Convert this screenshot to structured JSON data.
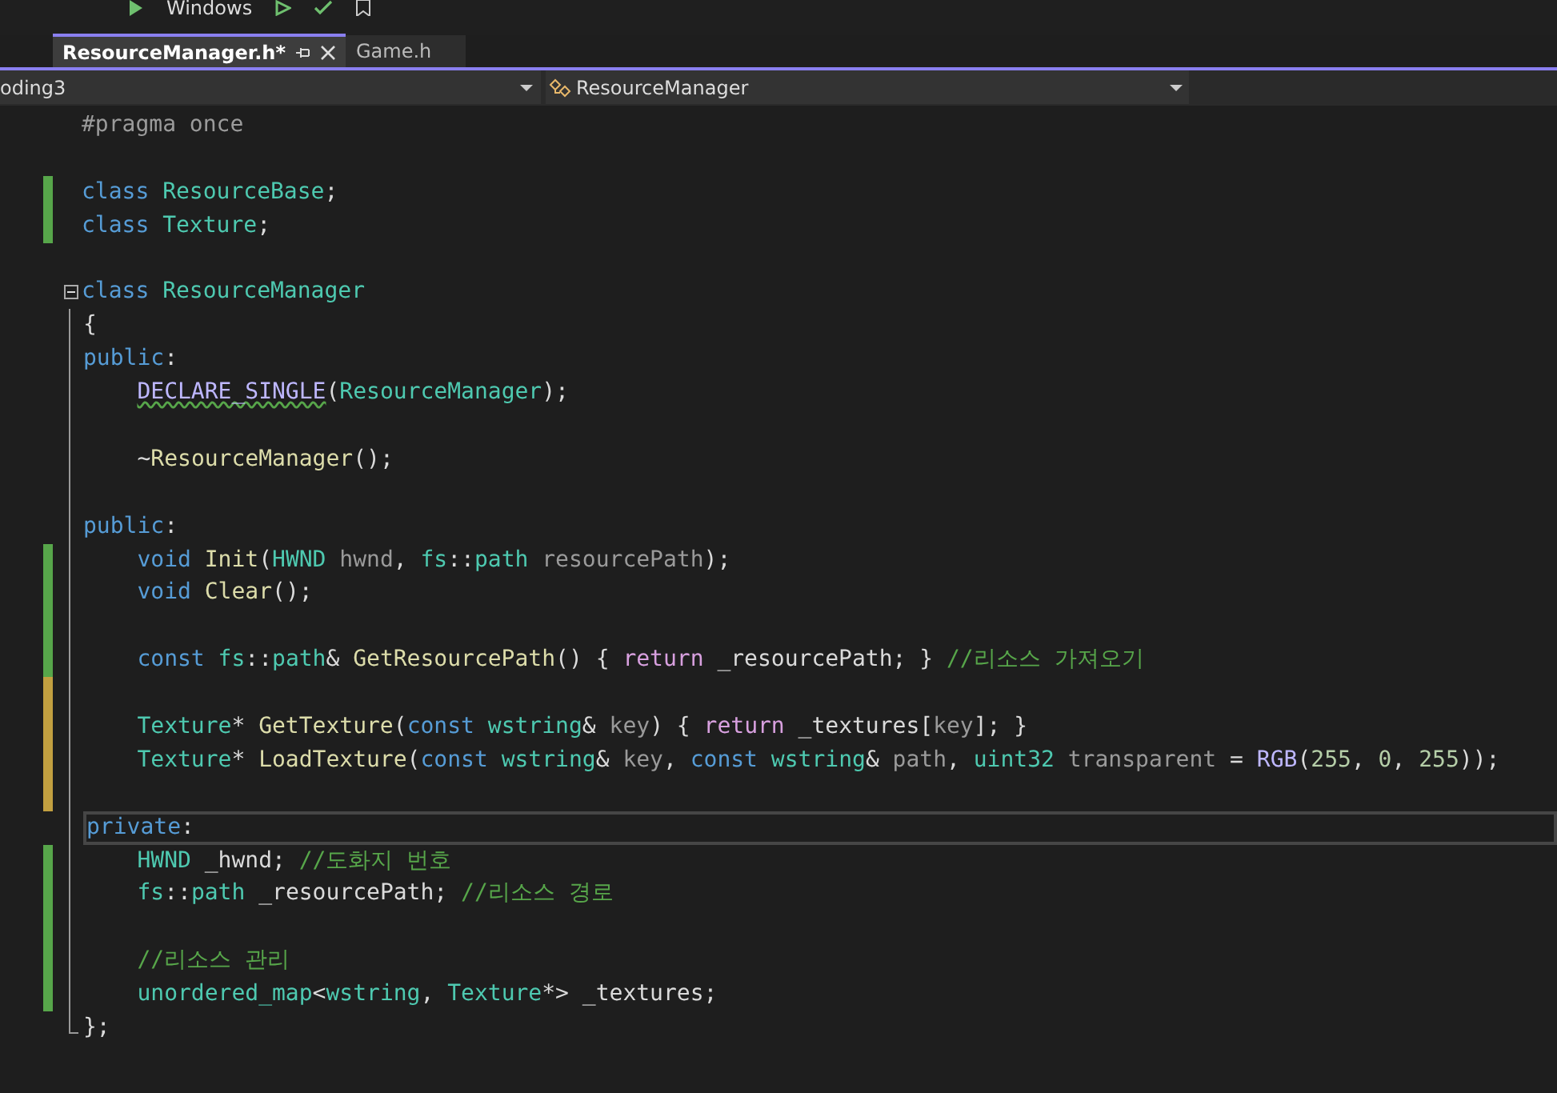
{
  "toolbar": {
    "config_label": "Windows"
  },
  "tabs": [
    {
      "label": "ResourceManager.h*",
      "selected": true
    },
    {
      "label": "Game.h",
      "selected": false
    }
  ],
  "nav": {
    "project": "oding3",
    "scope": "ResourceManager"
  },
  "lines": [
    {
      "current": false,
      "in_block": false,
      "tokens": [
        {
          "kind": "pre",
          "text": "#pragma once"
        }
      ]
    },
    {
      "current": false,
      "in_block": false
    },
    {
      "current": false,
      "in_block": false,
      "marker": {
        "color": "#57a64a"
      },
      "tokens": [
        {
          "kind": "kw",
          "text": "class "
        },
        {
          "kind": "type",
          "text": "ResourceBase"
        },
        {
          "kind": "plain",
          "text": ";"
        }
      ]
    },
    {
      "current": false,
      "in_block": false,
      "marker": {
        "color": "#57a64a"
      },
      "tokens": [
        {
          "kind": "kw",
          "text": "class "
        },
        {
          "kind": "type",
          "text": "Texture"
        },
        {
          "kind": "plain",
          "text": ";"
        }
      ]
    },
    {
      "current": false,
      "in_block": false
    },
    {
      "current": false,
      "collapse_box": true,
      "in_block": false,
      "tokens": [
        {
          "kind": "kw",
          "text": "class "
        },
        {
          "kind": "type",
          "text": "ResourceManager"
        }
      ]
    },
    {
      "current": false,
      "in_block": true,
      "tokens": [
        {
          "kind": "plain",
          "text": "{"
        }
      ]
    },
    {
      "current": false,
      "in_block": true,
      "tokens": [
        {
          "kind": "kw",
          "text": "public"
        },
        {
          "kind": "plain",
          "text": ":"
        }
      ]
    },
    {
      "current": false,
      "in_block": true,
      "tokens": [
        {
          "kind": "macro",
          "text": "    DECLARE_SINGLE",
          "warning": true
        },
        {
          "kind": "plain",
          "text": "(",
          "warning": false
        },
        {
          "kind": "type",
          "text": "ResourceManager",
          "warning": false
        },
        {
          "kind": "plain",
          "text": ");",
          "warning": false
        }
      ]
    },
    {
      "current": false,
      "in_block": true
    },
    {
      "current": false,
      "in_block": true,
      "tokens": [
        {
          "kind": "plain",
          "text": "    ~"
        },
        {
          "kind": "func",
          "text": "ResourceManager"
        },
        {
          "kind": "plain",
          "text": "();"
        }
      ]
    },
    {
      "current": false,
      "in_block": true
    },
    {
      "current": false,
      "in_block": true,
      "tokens": [
        {
          "kind": "kw",
          "text": "public"
        },
        {
          "kind": "plain",
          "text": ":"
        }
      ]
    },
    {
      "current": false,
      "in_block": true,
      "marker": {
        "color": "#57a64a"
      },
      "tokens": [
        {
          "kind": "kw",
          "text": "    void "
        },
        {
          "kind": "func",
          "text": "Init"
        },
        {
          "kind": "plain",
          "text": "("
        },
        {
          "kind": "type",
          "text": "HWND"
        },
        {
          "kind": "param",
          "text": " hwnd"
        },
        {
          "kind": "plain",
          "text": ", "
        },
        {
          "kind": "type",
          "text": "fs"
        },
        {
          "kind": "plain",
          "text": "::"
        },
        {
          "kind": "type",
          "text": "path"
        },
        {
          "kind": "param",
          "text": " resourcePath"
        },
        {
          "kind": "plain",
          "text": ");"
        }
      ]
    },
    {
      "current": false,
      "in_block": true,
      "marker": {
        "color": "#57a64a"
      },
      "tokens": [
        {
          "kind": "kw",
          "text": "    void "
        },
        {
          "kind": "func",
          "text": "Clear"
        },
        {
          "kind": "plain",
          "text": "();"
        }
      ]
    },
    {
      "current": false,
      "in_block": true,
      "marker": {
        "color": "#57a64a"
      }
    },
    {
      "current": false,
      "in_block": true,
      "marker": {
        "color": "#57a64a"
      },
      "tokens": [
        {
          "kind": "kw",
          "text": "    const "
        },
        {
          "kind": "type",
          "text": "fs"
        },
        {
          "kind": "plain",
          "text": "::"
        },
        {
          "kind": "type",
          "text": "path"
        },
        {
          "kind": "plain",
          "text": "& "
        },
        {
          "kind": "func",
          "text": "GetResourcePath"
        },
        {
          "kind": "plain",
          "text": "() { "
        },
        {
          "kind": "ctrl",
          "text": "return"
        },
        {
          "kind": "plain",
          "text": " _resourcePath; } "
        },
        {
          "kind": "comment",
          "text": "//리소스 가져오기"
        }
      ]
    },
    {
      "current": false,
      "in_block": true,
      "marker": {
        "color": "#c2a040"
      }
    },
    {
      "current": false,
      "in_block": true,
      "marker": {
        "color": "#c2a040"
      },
      "tokens": [
        {
          "kind": "type",
          "text": "    Texture"
        },
        {
          "kind": "plain",
          "text": "* "
        },
        {
          "kind": "func",
          "text": "GetTexture"
        },
        {
          "kind": "plain",
          "text": "("
        },
        {
          "kind": "kw",
          "text": "const "
        },
        {
          "kind": "type",
          "text": "wstring"
        },
        {
          "kind": "plain",
          "text": "& "
        },
        {
          "kind": "param",
          "text": "key"
        },
        {
          "kind": "plain",
          "text": ") { "
        },
        {
          "kind": "ctrl",
          "text": "return"
        },
        {
          "kind": "plain",
          "text": " _textures["
        },
        {
          "kind": "param",
          "text": "key"
        },
        {
          "kind": "plain",
          "text": "]; }"
        }
      ]
    },
    {
      "current": false,
      "in_block": true,
      "marker": {
        "color": "#c2a040"
      },
      "tokens": [
        {
          "kind": "type",
          "text": "    Texture"
        },
        {
          "kind": "plain",
          "text": "* "
        },
        {
          "kind": "func",
          "text": "LoadTexture"
        },
        {
          "kind": "plain",
          "text": "("
        },
        {
          "kind": "kw",
          "text": "const "
        },
        {
          "kind": "type",
          "text": "wstring"
        },
        {
          "kind": "plain",
          "text": "& "
        },
        {
          "kind": "param",
          "text": "key"
        },
        {
          "kind": "plain",
          "text": ", "
        },
        {
          "kind": "kw",
          "text": "const "
        },
        {
          "kind": "type",
          "text": "wstring"
        },
        {
          "kind": "plain",
          "text": "& "
        },
        {
          "kind": "param",
          "text": "path"
        },
        {
          "kind": "plain",
          "text": ", "
        },
        {
          "kind": "type",
          "text": "uint32"
        },
        {
          "kind": "param",
          "text": " transparent"
        },
        {
          "kind": "plain",
          "text": " = "
        },
        {
          "kind": "macro",
          "text": "RGB"
        },
        {
          "kind": "plain",
          "text": "("
        },
        {
          "kind": "num",
          "text": "255"
        },
        {
          "kind": "plain",
          "text": ", "
        },
        {
          "kind": "num",
          "text": "0"
        },
        {
          "kind": "plain",
          "text": ", "
        },
        {
          "kind": "num",
          "text": "255"
        },
        {
          "kind": "plain",
          "text": "));"
        }
      ]
    },
    {
      "current": false,
      "in_block": true,
      "marker": {
        "color": "#c2a040"
      }
    },
    {
      "current": true,
      "in_block": true,
      "tokens": [
        {
          "kind": "kw",
          "text": "private"
        },
        {
          "kind": "plain",
          "text": ":"
        }
      ]
    },
    {
      "current": false,
      "in_block": true,
      "marker": {
        "color": "#57a64a"
      },
      "tokens": [
        {
          "kind": "type",
          "text": "    HWND"
        },
        {
          "kind": "plain",
          "text": " _hwnd; "
        },
        {
          "kind": "comment",
          "text": "//도화지 번호"
        }
      ]
    },
    {
      "current": false,
      "in_block": true,
      "marker": {
        "color": "#57a64a"
      },
      "tokens": [
        {
          "kind": "type",
          "text": "    fs"
        },
        {
          "kind": "plain",
          "text": "::"
        },
        {
          "kind": "type",
          "text": "path"
        },
        {
          "kind": "plain",
          "text": " _resourcePath; "
        },
        {
          "kind": "comment",
          "text": "//리소스 경로"
        }
      ]
    },
    {
      "current": false,
      "in_block": true,
      "marker": {
        "color": "#57a64a"
      }
    },
    {
      "current": false,
      "in_block": true,
      "marker": {
        "color": "#57a64a"
      },
      "tokens": [
        {
          "kind": "comment",
          "text": "    //리소스 관리"
        }
      ]
    },
    {
      "current": false,
      "in_block": true,
      "marker": {
        "color": "#57a64a"
      },
      "tokens": [
        {
          "kind": "type",
          "text": "    unordered_map"
        },
        {
          "kind": "plain",
          "text": "<"
        },
        {
          "kind": "type",
          "text": "wstring"
        },
        {
          "kind": "plain",
          "text": ", "
        },
        {
          "kind": "type",
          "text": "Texture"
        },
        {
          "kind": "plain",
          "text": "*> _textures;"
        }
      ]
    },
    {
      "current": false,
      "in_block": true,
      "tokens": [
        {
          "kind": "plain",
          "text": "};"
        }
      ]
    }
  ]
}
